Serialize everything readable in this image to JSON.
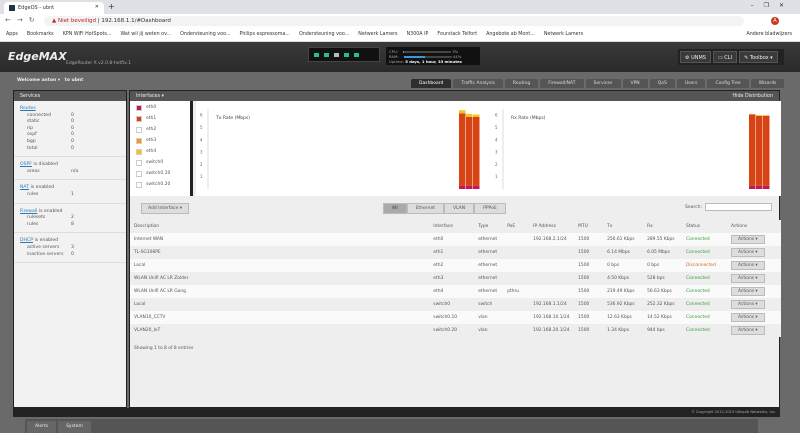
{
  "browser": {
    "tab_title": "EdgeOS - ubnt",
    "security": "Niet beveiligd",
    "url": "192.168.1.1/#Dashboard",
    "avatar": "A",
    "bookmarks": [
      "Apps",
      "Bookmarks",
      "KPN WiFi HotSpots...",
      "Wat wil jij weten ov...",
      "Ondersteuning voo...",
      "Philips espressoma...",
      "Ondersteuning voo...",
      "Netwerk Lamers",
      "N300A IP",
      "Fourstack Telfort",
      "Angebote ab Mont...",
      "Netwerk Lamers"
    ],
    "other_bookmarks": "Andere bladwijzers"
  },
  "header": {
    "logo": "EdgeMAX",
    "version": "EdgeRouter X v2.0.8-hotfix.1",
    "cpu_label": "CPU:",
    "cpu_value": "3%",
    "cpu_pct": 3,
    "ram_label": "RAM:",
    "ram_value": "44%",
    "ram_pct": 44,
    "uptime_label": "Uptime:",
    "uptime": "5 days, 1 hour, 33 minutes",
    "unms": "UNMS",
    "cli": "CLI",
    "toolbox": "Toolbox ▾",
    "ports": [
      "#22c08a",
      "#22c08a",
      "#bbbbbb",
      "#22c08a",
      "#22c08a"
    ]
  },
  "welcome": {
    "user": "Welcome anton ▾",
    "host": "to ubnt"
  },
  "nav": [
    "Dashboard",
    "Traffic Analysis",
    "Routing",
    "Firewall/NAT",
    "Services",
    "VPN",
    "QoS",
    "Users",
    "Config Tree",
    "Wizards"
  ],
  "services": {
    "title": "Services",
    "routes": {
      "link": "Routes",
      "items": [
        [
          "connected",
          "0"
        ],
        [
          "static",
          "0"
        ],
        [
          "rip",
          "0"
        ],
        [
          "ospf",
          "0"
        ],
        [
          "bgp",
          "0"
        ],
        [
          "total",
          "0"
        ]
      ]
    },
    "ospf": {
      "link": "OSPF",
      "status": "is disabled",
      "items": [
        [
          "areas",
          "n/a"
        ]
      ]
    },
    "nat": {
      "link": "NAT",
      "status": "is enabled",
      "items": [
        [
          "rules",
          "1"
        ]
      ]
    },
    "firewall": {
      "link": "Firewall",
      "status": "is enabled",
      "items": [
        [
          "rulesets",
          "2"
        ],
        [
          "rules",
          "8"
        ]
      ]
    },
    "dhcp": {
      "link": "DHCP",
      "status": "is enabled",
      "items": [
        [
          "active servers",
          "3"
        ],
        [
          "inactive servers",
          "0"
        ]
      ]
    }
  },
  "interfaces": {
    "title": "Interfaces ▾",
    "hide": "Hide Distribution",
    "legend": [
      {
        "name": "eth0",
        "color": "#c2185b"
      },
      {
        "name": "eth1",
        "color": "#d84315"
      },
      {
        "name": "eth2",
        "color": "#ffffff"
      },
      {
        "name": "eth3",
        "color": "#f39c12"
      },
      {
        "name": "eth4",
        "color": "#f5c518"
      },
      {
        "name": "switch0",
        "color": "#ffffff"
      },
      {
        "name": "switch0.10",
        "color": "#ffffff"
      },
      {
        "name": "switch0.20",
        "color": "#ffffff"
      }
    ],
    "add": "Add Interface ▾",
    "filters": [
      "All",
      "Ethernet",
      "VLAN",
      "PPPoE"
    ],
    "search": "Search:",
    "columns": [
      "Description",
      "Interface",
      "Type",
      "PoE",
      "IP Address",
      "MTU",
      "Tx",
      "Rx",
      "Status",
      "Actions"
    ],
    "rows": [
      [
        "Internet WAN",
        "eth0",
        "ethernet",
        "",
        "192.168.2.1/24",
        "1500",
        "256.61 Kbps",
        "289.55 Kbps",
        "Connected"
      ],
      [
        "TL-SG108PE",
        "eth1",
        "ethernet",
        "",
        "",
        "1500",
        "6.14 Mbps",
        "6.05 Mbps",
        "Connected"
      ],
      [
        "Local",
        "eth2",
        "ethernet",
        "",
        "",
        "1500",
        "0 bps",
        "0 bps",
        "Disconnected"
      ],
      [
        "WLAN Unifi AC LR Zolder",
        "eth3",
        "ethernet",
        "",
        "",
        "1500",
        "4.50 Kbps",
        "528 bps",
        "Connected"
      ],
      [
        "WLAN Unifi AC LR Gang",
        "eth4",
        "ethernet",
        "pthru",
        "",
        "1500",
        "219.49 Kbps",
        "56.63 Kbps",
        "Connected"
      ],
      [
        "Local",
        "switch0",
        "switch",
        "",
        "192.168.1.1/24",
        "1500",
        "536.92 Kbps",
        "252.32 Kbps",
        "Connected"
      ],
      [
        "VLAN10_CCTV",
        "switch0.10",
        "vlan",
        "",
        "192.168.10.1/24",
        "1500",
        "12.63 Kbps",
        "14.52 Kbps",
        "Connected"
      ],
      [
        "VLAN20_IoT",
        "switch0.20",
        "vlan",
        "",
        "192.168.20.1/24",
        "1500",
        "1.34 Kbps",
        "944 bps",
        "Connected"
      ]
    ],
    "actions": "Actions ▾",
    "showing": "Showing 1 to 8 of 8 entries"
  },
  "chart_data": [
    {
      "type": "bar",
      "title": "Tx Rate (Mbps)",
      "ylim": [
        0,
        6.5
      ],
      "yticks": [
        1,
        2,
        3,
        4,
        5,
        6
      ],
      "series": [
        {
          "name": "eth0",
          "values": [
            0.25,
            0.25,
            0.25
          ]
        },
        {
          "name": "eth1",
          "values": [
            5.9,
            5.6,
            5.6
          ]
        },
        {
          "name": "eth4",
          "values": [
            0.25,
            0.25,
            0.2
          ]
        }
      ]
    },
    {
      "type": "bar",
      "title": "Rx Rate (Mbps)",
      "ylim": [
        0,
        6.5
      ],
      "yticks": [
        1,
        2,
        3,
        4,
        5,
        6
      ],
      "series": [
        {
          "name": "eth0",
          "values": [
            0.25,
            0.25,
            0.25
          ]
        },
        {
          "name": "eth1",
          "values": [
            5.8,
            5.7,
            5.7
          ]
        },
        {
          "name": "eth4",
          "values": [
            0.05,
            0.05,
            0.05
          ]
        }
      ]
    }
  ],
  "footer": {
    "copyright": "© Copyright 2012-2019 Ubiquiti Networks, Inc.",
    "tabs": [
      "Alerts",
      "System"
    ]
  }
}
